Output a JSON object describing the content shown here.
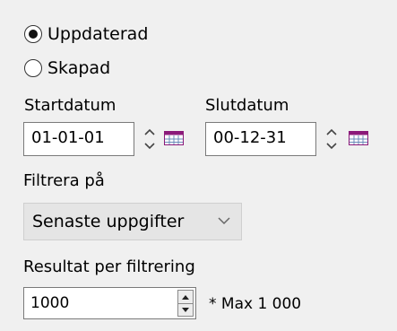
{
  "date_type": {
    "options": [
      {
        "label": "Uppdaterad",
        "checked": true
      },
      {
        "label": "Skapad",
        "checked": false
      }
    ]
  },
  "dates": {
    "start_label": "Startdatum",
    "start_value": "01-01-01",
    "end_label": "Slutdatum",
    "end_value": "00-12-31"
  },
  "filter": {
    "label": "Filtrera på",
    "selected": "Senaste uppgifter"
  },
  "results": {
    "label": "Resultat per filtrering",
    "value": "1000",
    "max_note": "* Max 1 000"
  },
  "icons": {
    "date_stepper": "up-down-arrows-icon",
    "calendar": "calendar-icon",
    "dropdown": "chevron-down-icon",
    "spinner": "spin-arrows-icon"
  },
  "colors": {
    "background": "#f0f0f0",
    "field_border": "#7a7a7a",
    "calendar_accent": "#8b1a7a"
  }
}
